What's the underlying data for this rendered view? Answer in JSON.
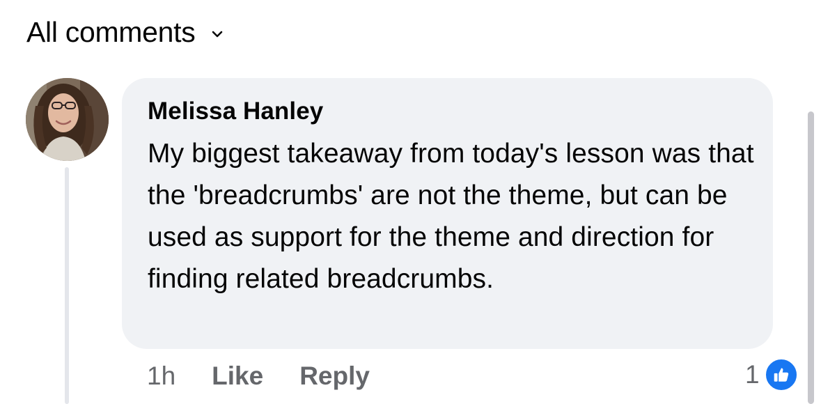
{
  "filter": {
    "label": "All comments",
    "icon": "chevron-down-icon"
  },
  "comment": {
    "avatar_icon": "avatar",
    "author": "Melissa Hanley",
    "text": "My biggest takeaway from today's lesson was that the 'breadcrumbs' are not the theme, but can be used as support for the theme and direction for finding related breadcrumbs.",
    "time": "1h",
    "like_label": "Like",
    "reply_label": "Reply",
    "reaction_count": "1",
    "reaction_icon": "thumbs-up-icon"
  },
  "colors": {
    "bubble": "#f0f2f5",
    "secondary_text": "#65676b",
    "like_blue": "#1877f2"
  }
}
